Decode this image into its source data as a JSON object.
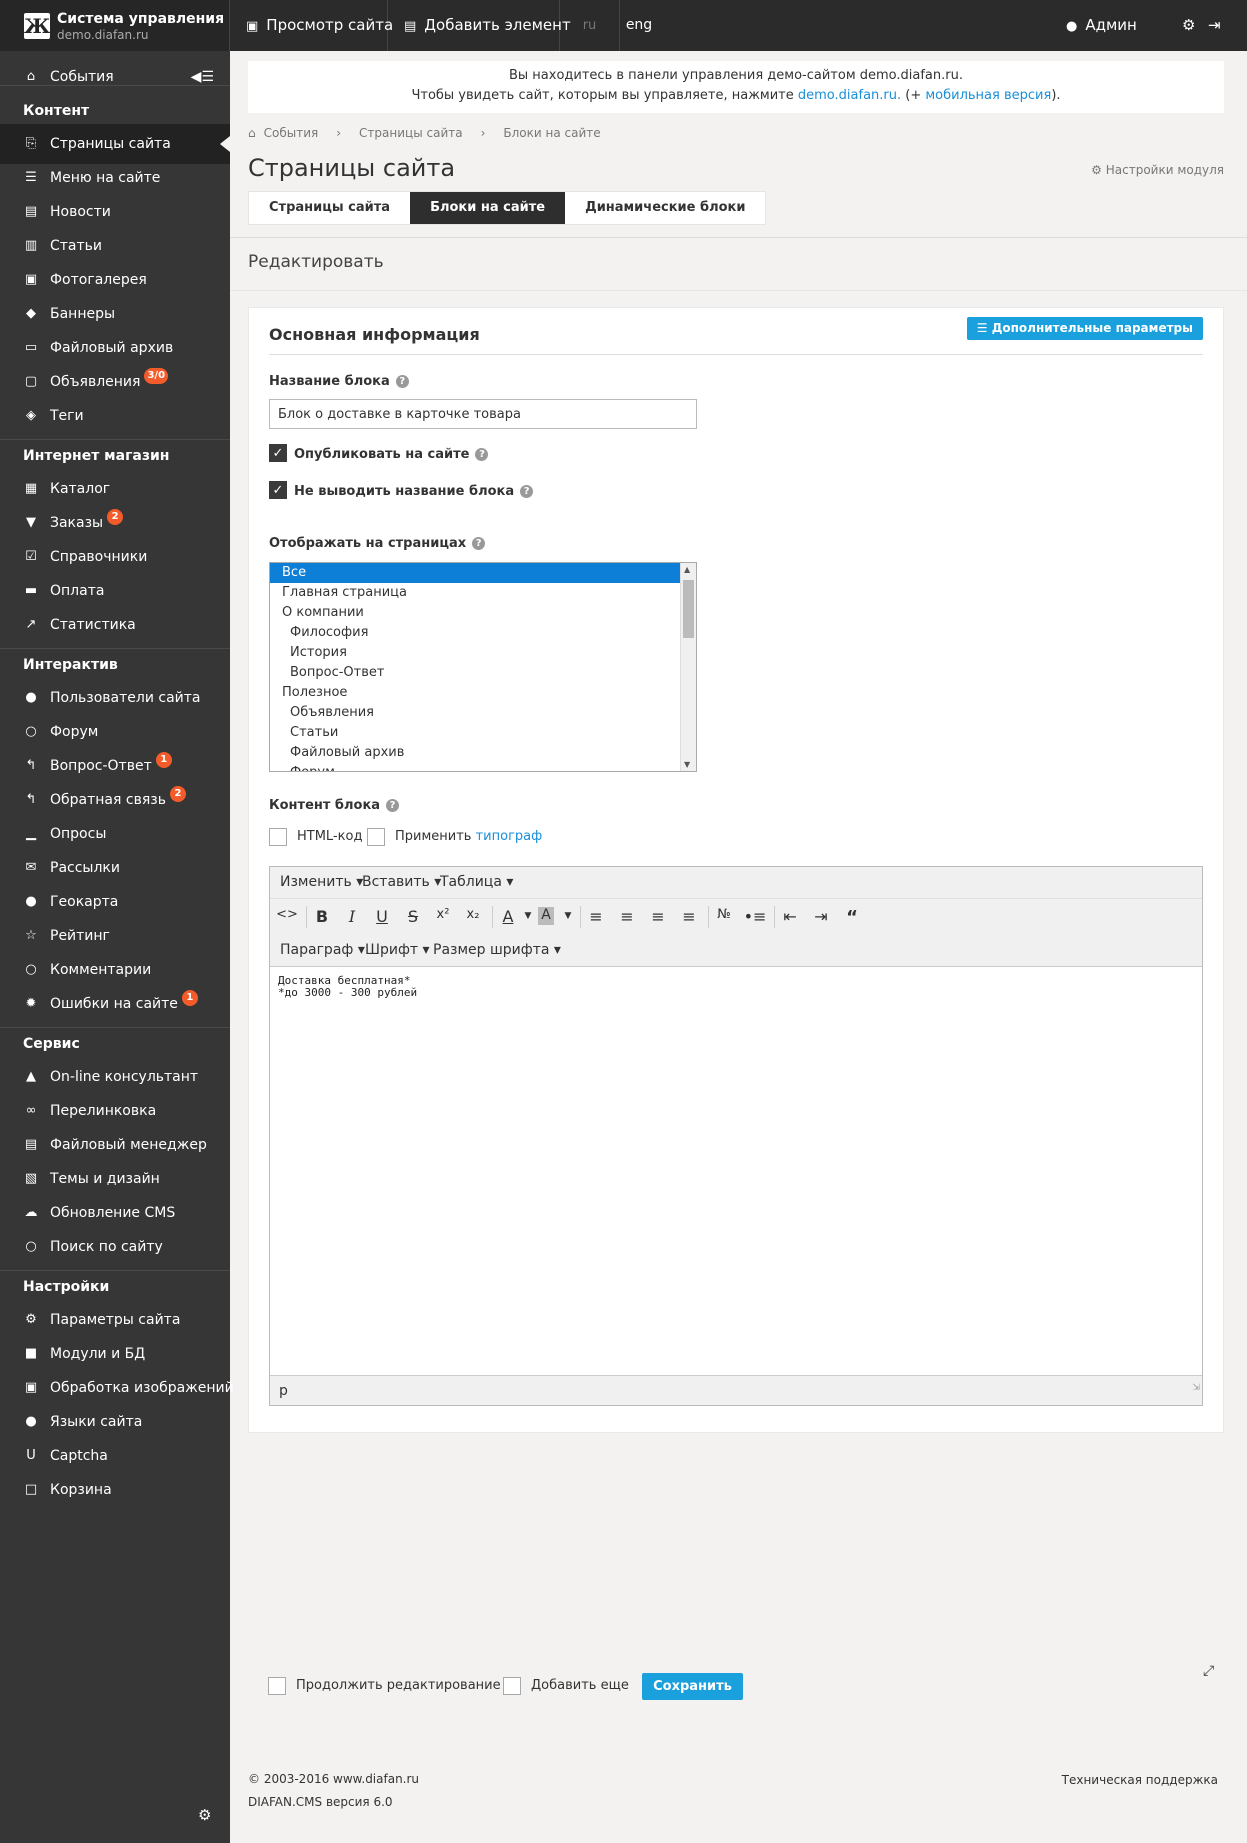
{
  "brand": {
    "logo": "Ж",
    "title": "Система управления",
    "subtitle": "demo.diafan.ru"
  },
  "topbar": {
    "view_site": "Просмотр сайта",
    "add_element": "Добавить элемент",
    "lang_ru": "ru",
    "lang_eng": "eng",
    "admin": "Админ"
  },
  "sidebar": {
    "events": "События",
    "sections": [
      {
        "title": "Контент",
        "items": [
          {
            "label": "Страницы сайта",
            "icon": "pages-icon",
            "active": true
          },
          {
            "label": "Меню на сайте",
            "icon": "menu-icon"
          },
          {
            "label": "Новости",
            "icon": "news-icon"
          },
          {
            "label": "Статьи",
            "icon": "articles-icon"
          },
          {
            "label": "Фотогалерея",
            "icon": "photo-icon"
          },
          {
            "label": "Баннеры",
            "icon": "banners-icon"
          },
          {
            "label": "Файловый архив",
            "icon": "folder-icon"
          },
          {
            "label": "Объявления",
            "icon": "ads-icon",
            "badge": "3/0"
          },
          {
            "label": "Теги",
            "icon": "tags-icon"
          }
        ]
      },
      {
        "title": "Интернет магазин",
        "items": [
          {
            "label": "Каталог",
            "icon": "catalog-icon"
          },
          {
            "label": "Заказы",
            "icon": "cart-icon",
            "badge": "2"
          },
          {
            "label": "Справочники",
            "icon": "check-icon"
          },
          {
            "label": "Оплата",
            "icon": "payment-icon"
          },
          {
            "label": "Статистика",
            "icon": "stats-icon"
          }
        ]
      },
      {
        "title": "Интерактив",
        "items": [
          {
            "label": "Пользователи сайта",
            "icon": "users-icon"
          },
          {
            "label": "Форум",
            "icon": "forum-icon"
          },
          {
            "label": "Вопрос-Ответ",
            "icon": "reply-icon",
            "badge": "1"
          },
          {
            "label": "Обратная связь",
            "icon": "feedback-icon",
            "badge": "2"
          },
          {
            "label": "Опросы",
            "icon": "polls-icon"
          },
          {
            "label": "Рассылки",
            "icon": "mail-icon"
          },
          {
            "label": "Геокарта",
            "icon": "map-pin-icon"
          },
          {
            "label": "Рейтинг",
            "icon": "star-icon"
          },
          {
            "label": "Комментарии",
            "icon": "comment-icon"
          },
          {
            "label": "Ошибки на сайте",
            "icon": "bug-icon",
            "badge": "1"
          }
        ]
      },
      {
        "title": "Сервис",
        "items": [
          {
            "label": "On-line консультант",
            "icon": "graduation-icon"
          },
          {
            "label": "Перелинковка",
            "icon": "links-icon"
          },
          {
            "label": "Файловый менеджер",
            "icon": "file-manager-icon"
          },
          {
            "label": "Темы и дизайн",
            "icon": "themes-icon"
          },
          {
            "label": "Обновление CMS",
            "icon": "cloud-icon"
          },
          {
            "label": "Поиск по сайту",
            "icon": "search-icon"
          }
        ]
      },
      {
        "title": "Настройки",
        "items": [
          {
            "label": "Параметры сайта",
            "icon": "params-icon"
          },
          {
            "label": "Модули и БД",
            "icon": "modules-icon"
          },
          {
            "label": "Обработка изображений",
            "icon": "image-proc-icon"
          },
          {
            "label": "Языки сайта",
            "icon": "globe-icon"
          },
          {
            "label": "Captcha",
            "icon": "captcha-icon"
          },
          {
            "label": "Корзина",
            "icon": "trash-icon"
          }
        ]
      }
    ]
  },
  "notice": {
    "line1": "Вы находитесь в панели управления демо-сайтом demo.diafan.ru.",
    "line2_pre": "Чтобы увидеть сайт, которым вы управляете, нажмите ",
    "link1": "demo.diafan.ru.",
    "line2_mid": " (+ ",
    "link2": "мобильная версия",
    "line2_post": ")."
  },
  "breadcrumbs": [
    "События",
    "Страницы сайта",
    "Блоки на сайте"
  ],
  "page_title": "Страницы сайта",
  "module_settings": "Настройки модуля",
  "tabs": [
    {
      "label": "Страницы сайта",
      "active": false
    },
    {
      "label": "Блоки на сайте",
      "active": true
    },
    {
      "label": "Динамические блоки",
      "active": false
    }
  ],
  "edit_title": "Редактировать",
  "form": {
    "section_title": "Основная информация",
    "extra_params": "Дополнительные параметры",
    "name_label": "Название блока",
    "name_value": "Блок о доставке в карточке товара",
    "publish_label": "Опубликовать на сайте",
    "publish_checked": true,
    "hide_title_label": "Не выводить название блока",
    "hide_title_checked": true,
    "pages_label": "Отображать на страницах",
    "pages": [
      {
        "label": "Все",
        "selected": true,
        "level": 0
      },
      {
        "label": "Главная страница",
        "level": 0
      },
      {
        "label": "О компании",
        "level": 0
      },
      {
        "label": "Философия",
        "level": 1
      },
      {
        "label": "История",
        "level": 1
      },
      {
        "label": "Вопрос-Ответ",
        "level": 1
      },
      {
        "label": "Полезное",
        "level": 0
      },
      {
        "label": "Объявления",
        "level": 1
      },
      {
        "label": "Статьи",
        "level": 1
      },
      {
        "label": "Файловый архив",
        "level": 1
      },
      {
        "label": "Форум",
        "level": 1
      }
    ],
    "content_label": "Контент блока",
    "html_code": "HTML-код",
    "apply_pre": "Применить ",
    "typograph": "типограф"
  },
  "editor": {
    "menus": [
      "Изменить",
      "Вставить",
      "Таблица"
    ],
    "menus2": [
      "Параграф",
      "Шрифт",
      "Размер шрифта"
    ],
    "content": "Доставка бесплатная*\n*до 3000 - 300 рублей",
    "status": "p"
  },
  "bottom": {
    "continue_edit": "Продолжить редактирование",
    "add_more": "Добавить еще",
    "save": "Сохранить"
  },
  "footer": {
    "copyright": "© 2003-2016 www.diafan.ru",
    "version": "DIAFAN.CMS версия 6.0",
    "support": "Техническая поддержка"
  }
}
